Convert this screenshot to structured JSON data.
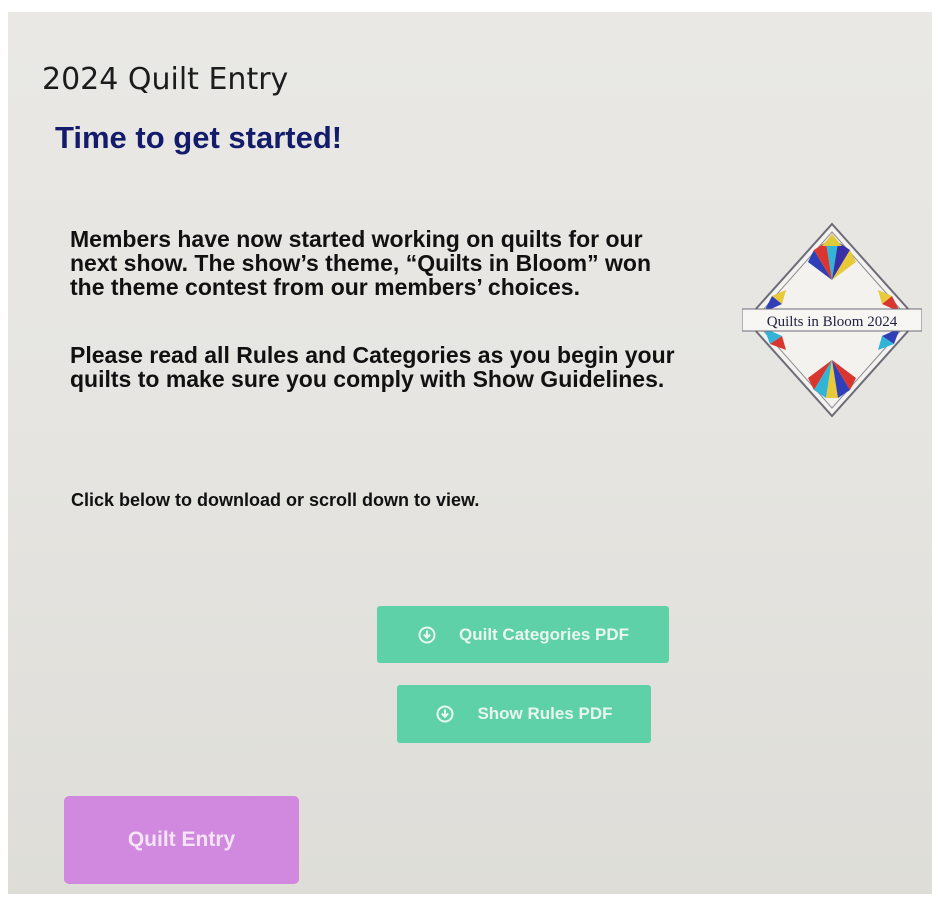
{
  "page": {
    "title": "2024 Quilt Entry",
    "subtitle": "Time to get started!"
  },
  "content": {
    "paragraph1": "Members have now started working on quilts for our next show. The show’s theme, “Quilts in Bloom” won the theme contest from our members’ choices.",
    "paragraph2": "Please read all Rules and Categories as you begin your quilts to make sure you comply with Show Guidelines.",
    "hint": "Click below to download or scroll down to view."
  },
  "logo": {
    "text": "Quilts in Bloom  2024"
  },
  "buttons": {
    "categories": {
      "label": "Quilt Categories PDF",
      "icon": "download-circle-icon"
    },
    "rules": {
      "label": "Show Rules PDF",
      "icon": "download-circle-icon"
    },
    "entry": {
      "label": "Quilt Entry"
    }
  },
  "colors": {
    "subtitle": "#131c6b",
    "download_button": "#5fd1a8",
    "entry_button": "#d188df"
  }
}
